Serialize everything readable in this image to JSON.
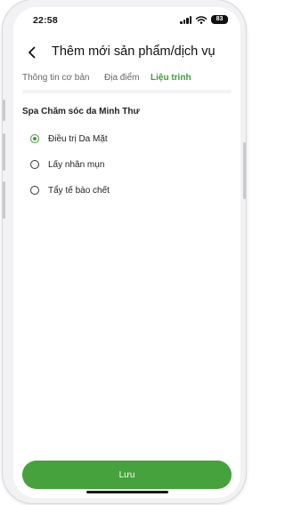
{
  "status_bar": {
    "time": "22:58",
    "battery": "83"
  },
  "header": {
    "back_icon": "chevron-left-icon",
    "title": "Thêm mới sản phẩm/dịch vụ"
  },
  "tabs": [
    {
      "label": "Thông tin cơ bản",
      "active": false
    },
    {
      "label": "Địa điểm",
      "active": false
    },
    {
      "label": "Liệu trình",
      "active": true
    }
  ],
  "section": {
    "title": "Spa Chăm sóc da Minh Thư",
    "options": [
      {
        "label": "Điều trị Da Mặt",
        "selected": true
      },
      {
        "label": "Lấy nhân mụn",
        "selected": false
      },
      {
        "label": "Tẩy tế bào chết",
        "selected": false
      }
    ]
  },
  "save_button": {
    "label": "Lưu"
  },
  "colors": {
    "accent": "#45a23c",
    "active_tab": "#3c9e35",
    "text": "#222222"
  }
}
